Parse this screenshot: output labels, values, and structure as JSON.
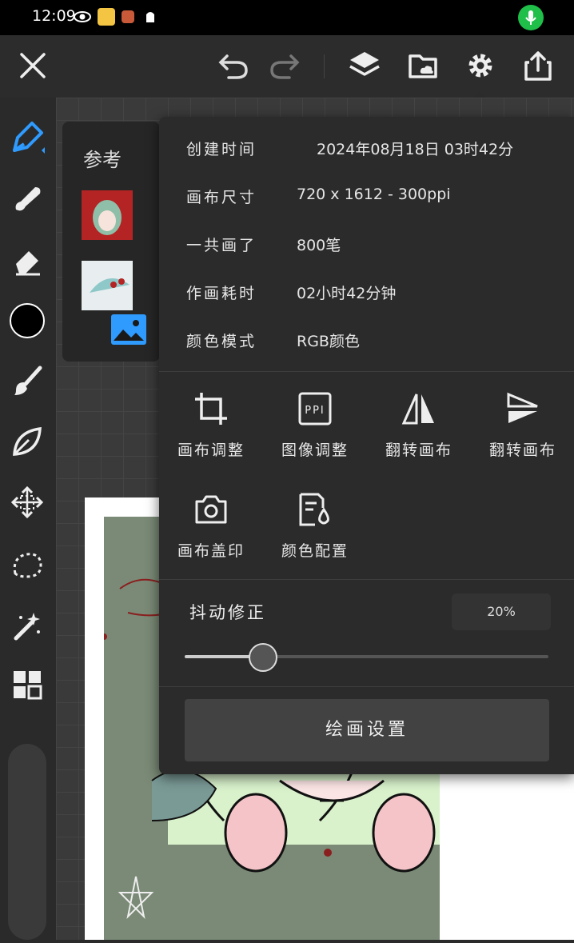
{
  "status_bar": {
    "time": "12:09"
  },
  "toolbar": {
    "icons": [
      "close-icon",
      "undo-icon",
      "redo-icon",
      "layers-icon",
      "cloud-folder-icon",
      "gear-icon",
      "share-icon"
    ]
  },
  "reference_panel": {
    "label": "参考"
  },
  "canvas_info": {
    "rows": [
      {
        "key": "创建时间",
        "value": "2024年08月18日 03时42分"
      },
      {
        "key": "画布尺寸",
        "value": "720 x 1612 - 300ppi"
      },
      {
        "key": "一共画了",
        "value": "800笔"
      },
      {
        "key": "作画耗时",
        "value": "02小时42分钟"
      },
      {
        "key": "颜色模式",
        "value": "RGB颜色"
      }
    ]
  },
  "actions": [
    {
      "label": "画布调整",
      "icon": "crop-icon"
    },
    {
      "label": "图像调整",
      "icon": "ppi-icon"
    },
    {
      "label": "翻转画布",
      "icon": "flip-horizontal-icon"
    },
    {
      "label": "翻转画布",
      "icon": "flip-vertical-icon"
    },
    {
      "label": "画布盖印",
      "icon": "camera-icon"
    },
    {
      "label": "颜色配置",
      "icon": "color-profile-icon"
    }
  ],
  "stabilizer": {
    "label": "抖动修正",
    "value_text": "20%",
    "value": 0.2
  },
  "paint_settings_label": "绘画设置",
  "colors": {
    "accent": "#2f9bff",
    "mic": "#1fbf4a",
    "current_color": "#000000"
  }
}
